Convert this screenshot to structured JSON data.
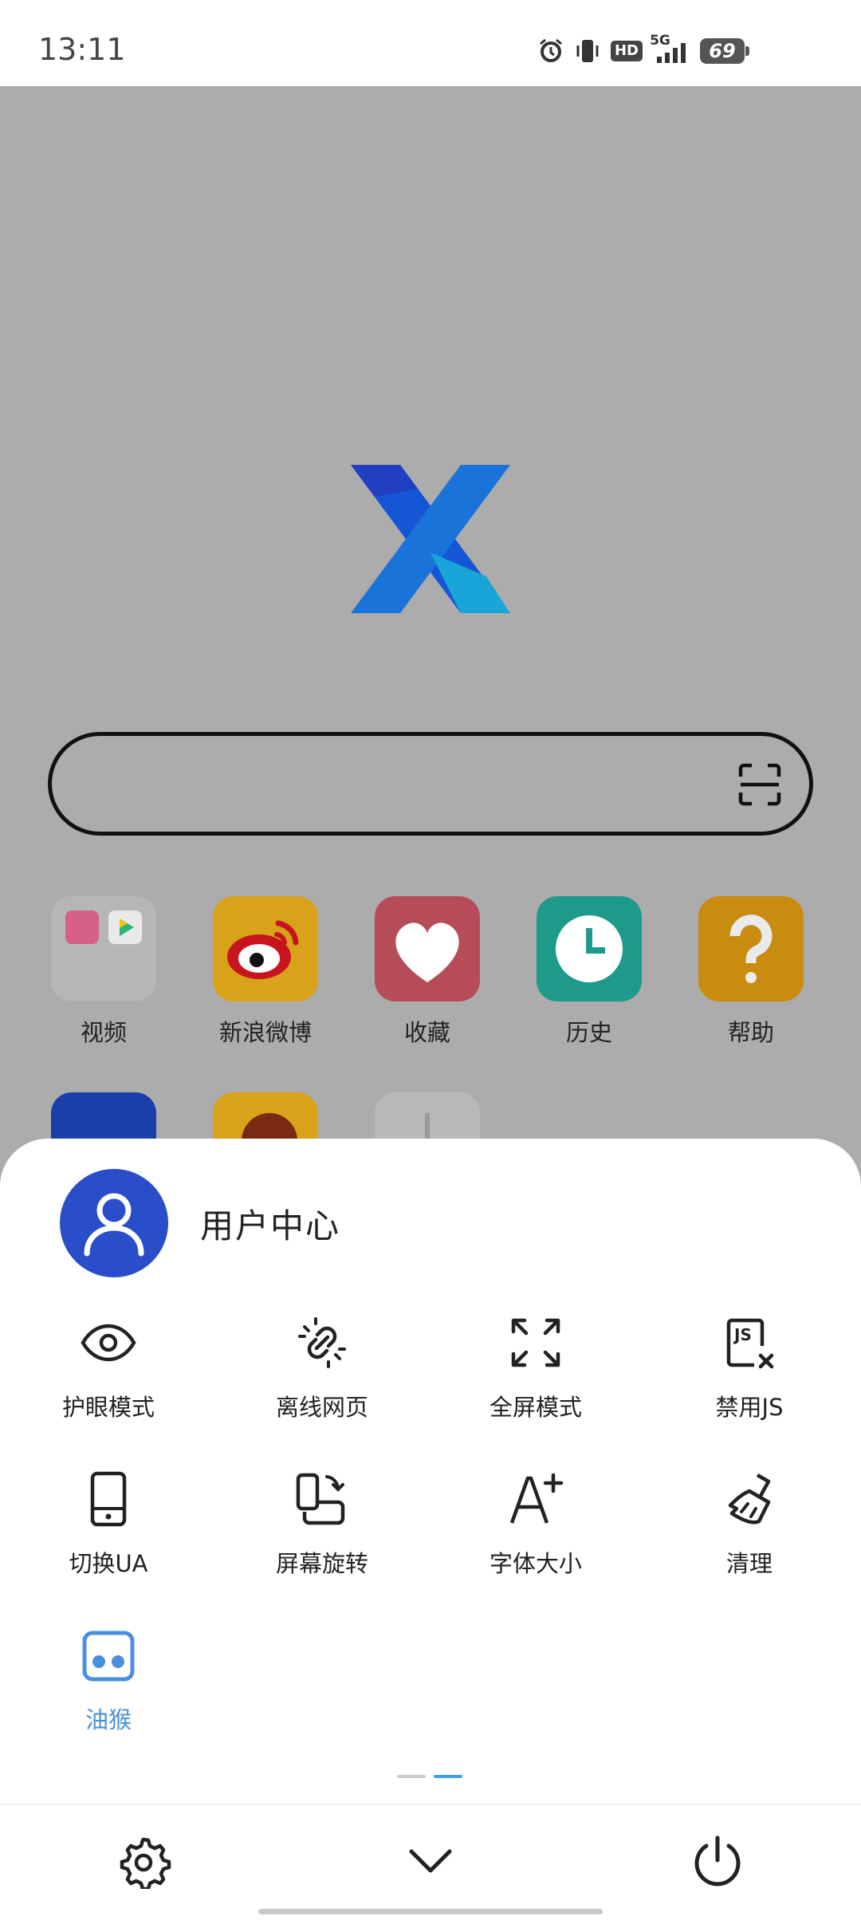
{
  "status_bar": {
    "time": "13:11",
    "hd_label": "HD",
    "network_label": "5G",
    "battery_level": "69"
  },
  "browser": {
    "logo_icon": "x-browser-logo-icon",
    "search": {
      "placeholder": "",
      "scan_icon": "scan-qr-icon"
    },
    "shortcuts": [
      {
        "label": "视频",
        "icon": "video-folder-icon",
        "color": "#b6b6b6"
      },
      {
        "label": "新浪微博",
        "icon": "weibo-icon",
        "color": "#d8a21a"
      },
      {
        "label": "收藏",
        "icon": "heart-icon",
        "color": "#b64c57"
      },
      {
        "label": "历史",
        "icon": "clock-icon",
        "color": "#1e9a8a"
      },
      {
        "label": "帮助",
        "icon": "question-icon",
        "color": "#c98b10"
      }
    ]
  },
  "sheet": {
    "user_center": "用户中心",
    "tools": [
      {
        "label": "护眼模式",
        "icon": "eye-icon"
      },
      {
        "label": "离线网页",
        "icon": "offline-link-icon"
      },
      {
        "label": "全屏模式",
        "icon": "fullscreen-icon"
      },
      {
        "label": "禁用JS",
        "icon": "disable-js-icon"
      },
      {
        "label": "切换UA",
        "icon": "phone-icon"
      },
      {
        "label": "屏幕旋转",
        "icon": "rotate-screen-icon"
      },
      {
        "label": "字体大小",
        "icon": "font-size-icon"
      },
      {
        "label": "清理",
        "icon": "broom-icon"
      },
      {
        "label": "油猴",
        "icon": "tampermonkey-icon",
        "active": true
      }
    ],
    "pager": {
      "pages": 2,
      "current": 2
    },
    "accent_color": "#4a8fdc"
  },
  "bottom_bar": {
    "settings_icon": "gear-icon",
    "collapse_icon": "chevron-down-icon",
    "exit_icon": "power-icon"
  }
}
